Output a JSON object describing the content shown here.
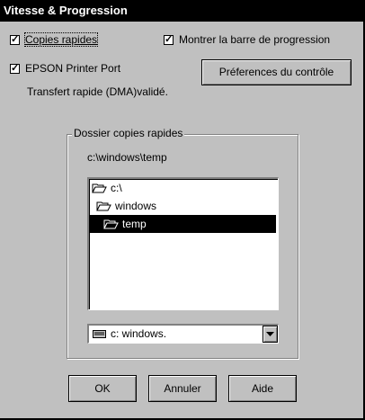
{
  "window": {
    "title": "Vitesse & Progression"
  },
  "options": {
    "fast_copies": {
      "label": "Copies rapides",
      "checked": true
    },
    "show_progress": {
      "label": "Montrer la barre de progression",
      "checked": true
    },
    "printer_port": {
      "label": "EPSON Printer Port",
      "checked": true
    },
    "control_prefs_button": "Préferences du contrôle",
    "dma_status": "Transfert rapide (DMA)validé."
  },
  "folder_group": {
    "legend": "Dossier copies rapides",
    "current_path": "c:\\windows\\temp",
    "tree": [
      {
        "label": "c:\\",
        "selected": false
      },
      {
        "label": "windows",
        "selected": false
      },
      {
        "label": "temp",
        "selected": true
      }
    ],
    "drive": {
      "label": "c:  windows.",
      "icon": "drive-icon"
    }
  },
  "buttons": {
    "ok": "OK",
    "cancel": "Annuler",
    "help": "Aide"
  },
  "colors": {
    "face": "#c0c0c0",
    "selection": "#000000",
    "title_bg": "#000000"
  }
}
